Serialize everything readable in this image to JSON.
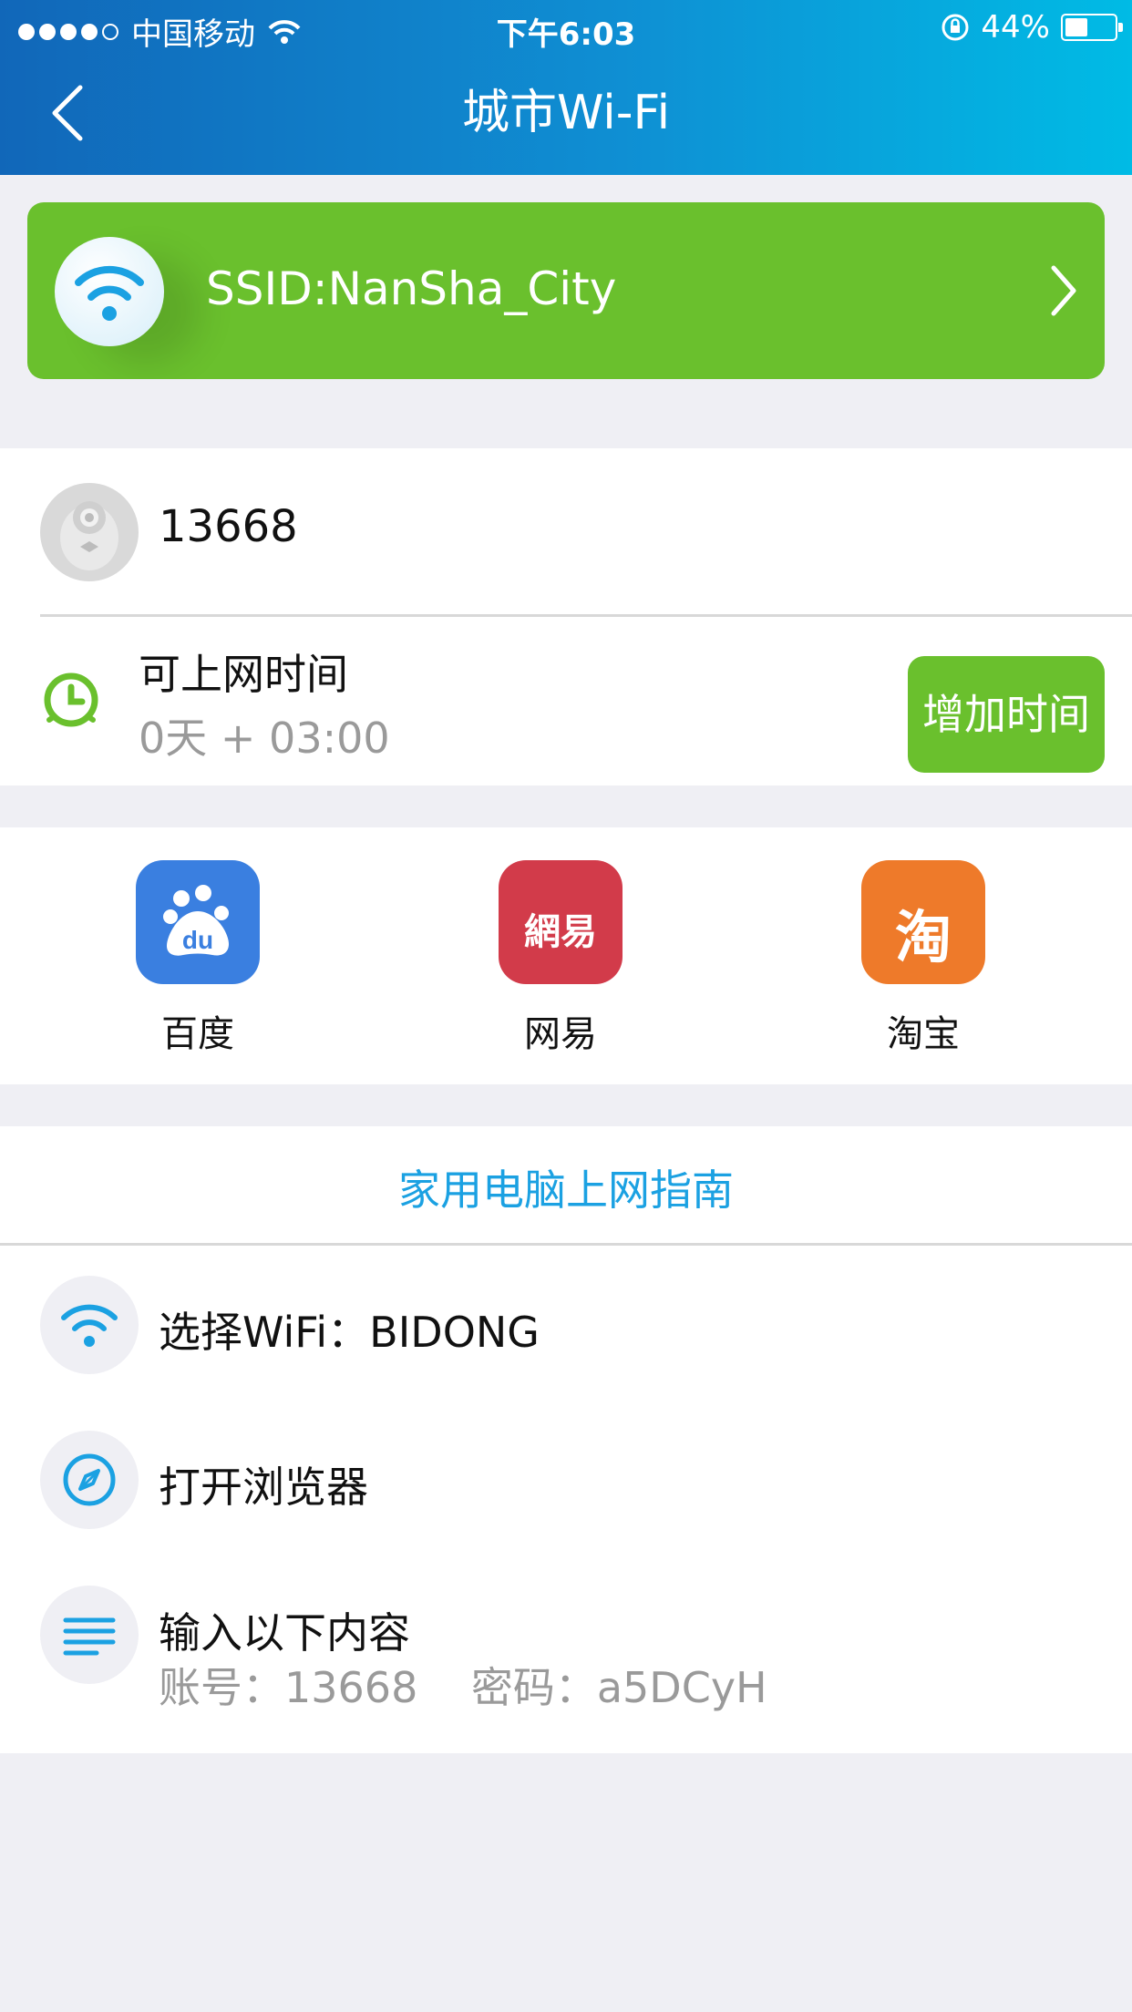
{
  "status_bar": {
    "carrier": "中国移动",
    "time": "下午6:03",
    "battery": "44%"
  },
  "header": {
    "title": "城市Wi-Fi"
  },
  "ssid": {
    "label": "SSID:NanSha_City"
  },
  "account": {
    "user_id": "13668",
    "time_label": "可上网时间",
    "time_value": "0天 + 03:00",
    "add_time_button": "增加时间"
  },
  "apps": [
    {
      "name": "百度",
      "icon": "baidu-icon",
      "color": "#3a7fe0",
      "glyph": "du"
    },
    {
      "name": "网易",
      "icon": "netease-icon",
      "color": "#d23b4a",
      "glyph": "網易"
    },
    {
      "name": "淘宝",
      "icon": "taobao-icon",
      "color": "#ee7a2a",
      "glyph": "淘"
    }
  ],
  "guide": {
    "title": "家用电脑上网指南",
    "steps": [
      {
        "text": "选择WiFi：BIDONG"
      },
      {
        "text": "打开浏览器"
      },
      {
        "text": "输入以下内容",
        "sub": "账号：13668    密码：a5DCyH"
      }
    ]
  },
  "colors": {
    "accent_green": "#6ac02d",
    "link_blue": "#1ba1e2",
    "header_start": "#1167b9",
    "header_end": "#00bbe5"
  }
}
